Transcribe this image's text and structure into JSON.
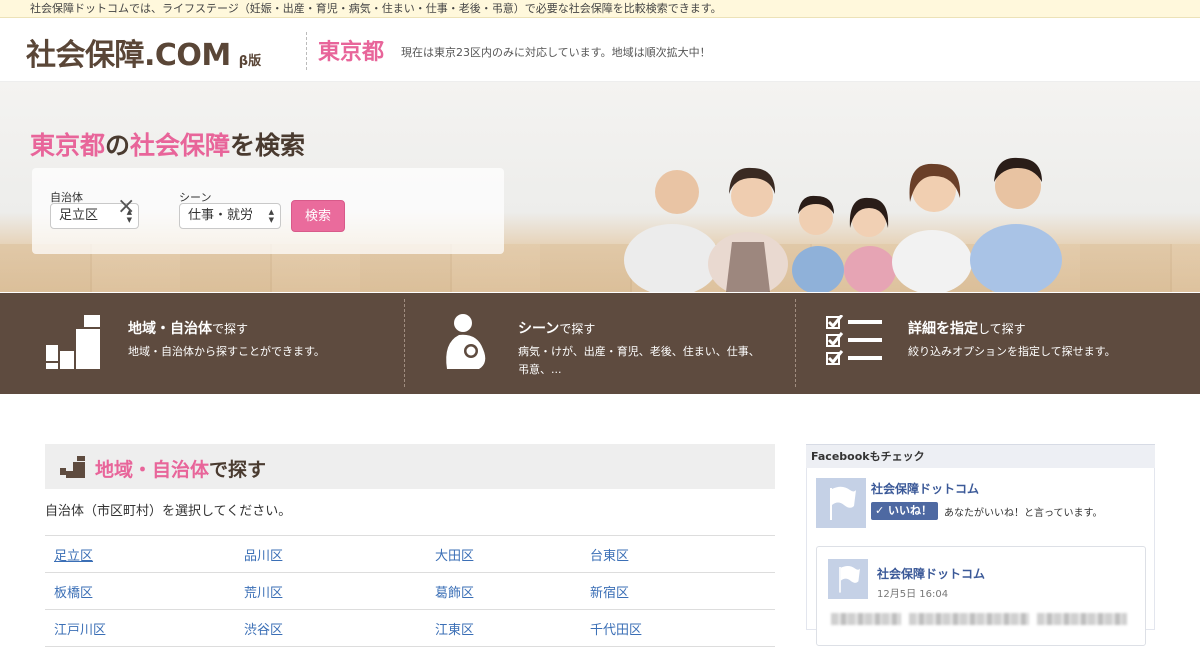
{
  "notice": "社会保障ドットコムでは、ライフステージ（妊娠・出産・育児・病気・住まい・仕事・老後・弔意）で必要な社会保障を比較検索できます。",
  "header": {
    "logo": "社会保障.COM",
    "beta": "β版",
    "prefecture": "東京都",
    "note": "現在は東京23区内のみに対応しています。地域は順次拡大中！"
  },
  "hero": {
    "title_pref": "東京都",
    "title_no": "の",
    "title_hosho": "社会保障",
    "title_wo": "を検索",
    "municipality_label": "自治体",
    "municipality_value": "足立区",
    "scene_label": "シーン",
    "scene_value": "仕事・就労",
    "times_sign": "×",
    "search_button": "検索"
  },
  "features": [
    {
      "title_bold": "地域・自治体",
      "title_rest": "で探す",
      "desc": "地域・自治体から探すことができます。",
      "icon": "buildings-icon"
    },
    {
      "title_bold": "シーン",
      "title_rest": "で探す",
      "desc": "病気・けが、出産・育児、老後、住まい、仕事、弔意、...",
      "icon": "mother-child-icon"
    },
    {
      "title_bold": "詳細を指定",
      "title_rest": "して探す",
      "desc": "絞り込みオプションを指定して探せます。",
      "icon": "checklist-icon"
    }
  ],
  "section": {
    "title_pink": "地域・自治体",
    "title_rest": "で探す",
    "instruction": "自治体（市区町村）を選択してください。",
    "wards": [
      [
        "足立区",
        "品川区",
        "大田区",
        "台東区"
      ],
      [
        "板橋区",
        "荒川区",
        "葛飾区",
        "新宿区"
      ],
      [
        "江戸川区",
        "渋谷区",
        "江東区",
        "千代田区"
      ]
    ]
  },
  "facebook": {
    "header": "Facebookもチェック",
    "page_name": "社会保障ドットコム",
    "like_button": "✓ いいね！",
    "like_text": "あなたがいいね！と言っています。",
    "post_name": "社会保障ドットコム",
    "post_date": "12月5日 16:04"
  },
  "colors": {
    "accent_pink": "#e8659a",
    "brown": "#5e4b3f",
    "link_blue": "#3b6fb6",
    "fb_blue": "#4e69a2"
  }
}
